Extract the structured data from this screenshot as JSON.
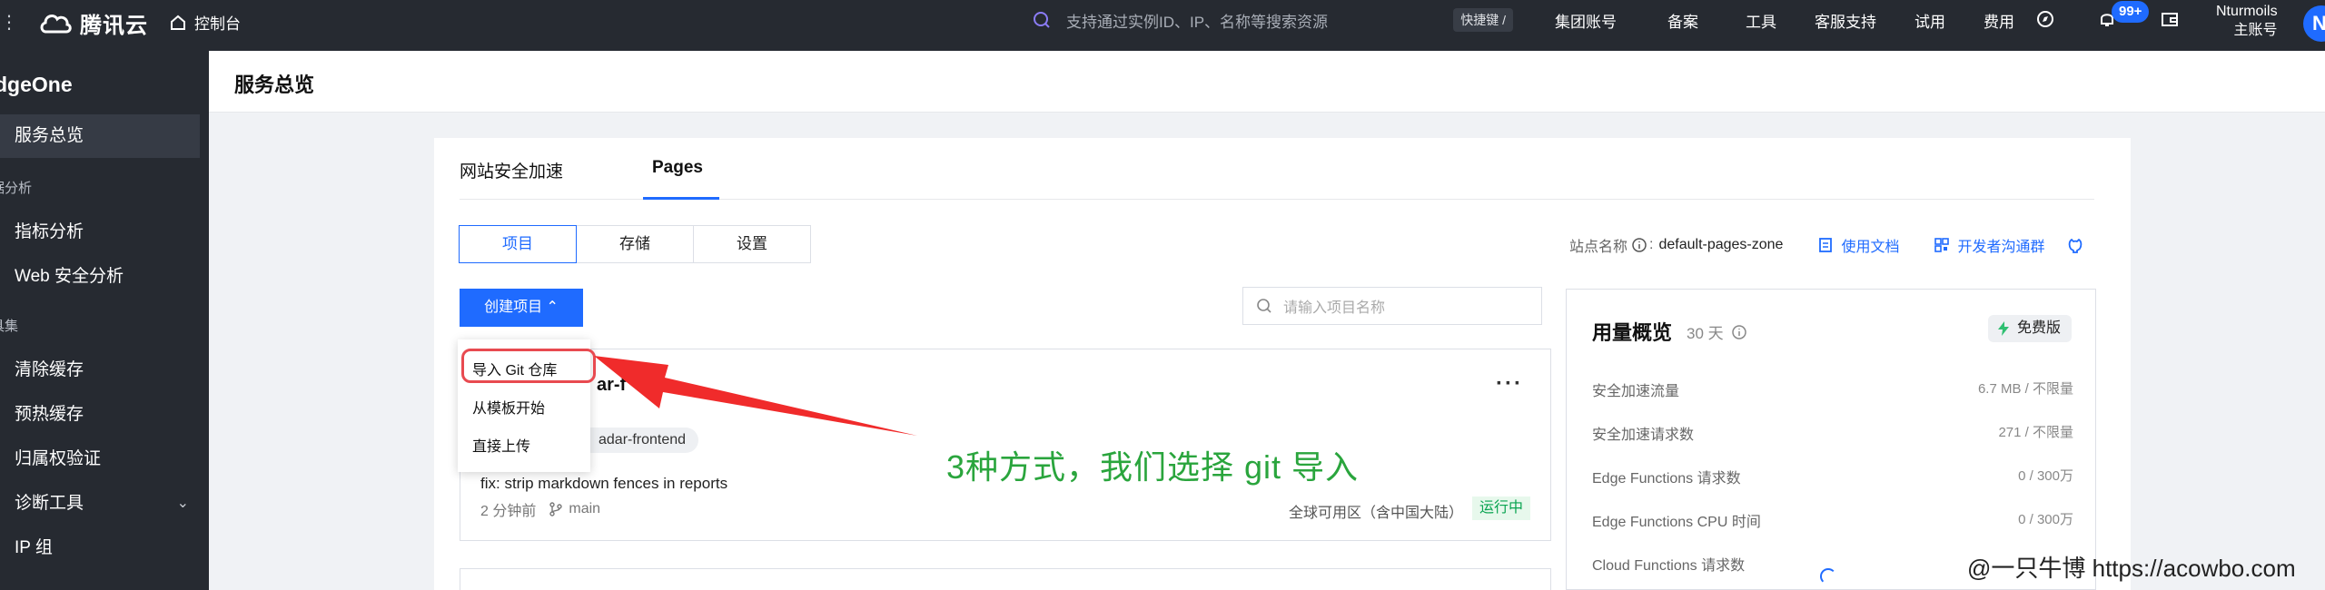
{
  "topbar": {
    "brand": "腾讯云",
    "console": "控制台",
    "search_placeholder": "支持通过实例ID、IP、名称等搜索资源",
    "shortcut": "快捷键 /",
    "nav": [
      "集团账号",
      "备案",
      "工具",
      "客服支持",
      "试用",
      "费用"
    ],
    "notification_count": "99+",
    "user_name": "Nturmoils",
    "user_role": "主账号",
    "avatar_letter": "N"
  },
  "sidebar": {
    "title": "dgeOne",
    "items": [
      {
        "label": "服务总览",
        "active": true
      },
      {
        "label": "指标分析"
      },
      {
        "label": "Web 安全分析"
      },
      {
        "label": "清除缓存"
      },
      {
        "label": "预热缓存"
      },
      {
        "label": "归属权验证"
      },
      {
        "label": "诊断工具"
      },
      {
        "label": "IP 组"
      }
    ],
    "groups": [
      "据分析",
      "具集"
    ]
  },
  "header": {
    "title": "服务总览"
  },
  "tabs": [
    {
      "label": "网站安全加速"
    },
    {
      "label": "Pages",
      "active": true
    }
  ],
  "segments": [
    {
      "label": "项目",
      "active": true
    },
    {
      "label": "存储"
    },
    {
      "label": "设置"
    }
  ],
  "site": {
    "label": "站点名称",
    "value": "default-pages-zone",
    "docs_link": "使用文档",
    "community_link": "开发者沟通群"
  },
  "create_button": "创建项目",
  "project_search_placeholder": "请输入项目名称",
  "dropdown": {
    "items": [
      "导入 Git 仓库",
      "从模板开始",
      "直接上传"
    ],
    "highlighted": "导入 Git 仓库"
  },
  "project": {
    "name": "ar-f",
    "repo": "adar-frontend",
    "commit_message": "fix: strip markdown fences in reports",
    "time": "2 分钟前",
    "branch": "main",
    "region": "全球可用区（含中国大陆）",
    "status": "运行中"
  },
  "usage": {
    "title": "用量概览",
    "period": "30 天",
    "plan": "免费版",
    "rows": [
      {
        "label": "安全加速流量",
        "value": "6.7 MB / 不限量"
      },
      {
        "label": "安全加速请求数",
        "value": "271 / 不限量"
      },
      {
        "label": "Edge Functions 请求数",
        "value": "0 / 300万"
      },
      {
        "label": "Edge Functions CPU 时间",
        "value": "0 / 300万"
      },
      {
        "label": "Cloud Functions 请求数",
        "value": ""
      }
    ]
  },
  "annotation": {
    "text": "3种方式，我们选择 git 导入",
    "color": "#2aa53d",
    "arrow_color": "#f02b2b"
  },
  "watermark": "@一只牛博 https://acowbo.com",
  "colors": {
    "brand": "#1f6bff",
    "topbar_bg": "#262a31",
    "status_green": "#0aa451"
  }
}
